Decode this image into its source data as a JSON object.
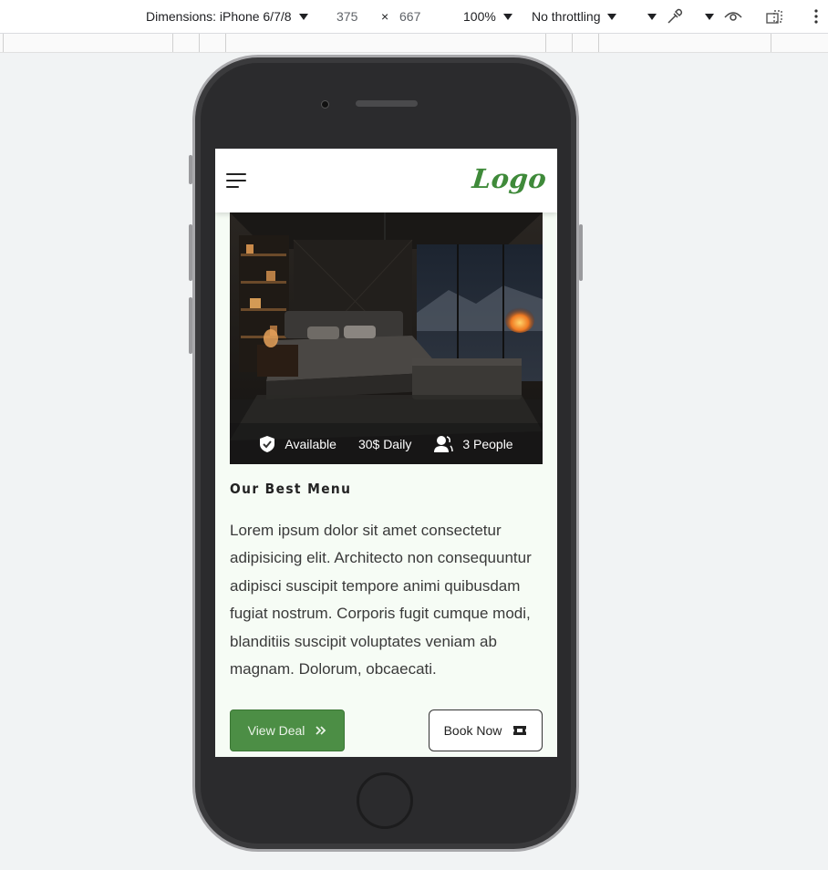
{
  "devtools": {
    "device_label": "Dimensions: iPhone 6/7/8",
    "width_value": "375",
    "times_symbol": "×",
    "height_value": "667",
    "zoom_label": "100%",
    "throttling_label": "No throttling",
    "icons": [
      "caret-down-icon",
      "eyedropper-icon",
      "eye-icon",
      "rotate-icon",
      "more-vert-icon"
    ]
  },
  "app": {
    "logo_text": "Logo",
    "brand_color": "#3f8a3a",
    "info_bar": {
      "availability": "Available",
      "price": "30$ Daily",
      "capacity": "3 People"
    },
    "section_title": "Our Best Menu",
    "description": "Lorem ipsum dolor sit amet consectetur adipisicing elit. Architecto non consequuntur adipisci suscipit tempore animi quibusdam fugiat nostrum. Corporis fugit cumque modi, blanditiis suscipit voluptates veniam ab magnam. Dolorum, obcaecati.",
    "view_deal_label": "View Deal",
    "book_now_label": "Book Now",
    "primary_color": "#4c8e45"
  }
}
